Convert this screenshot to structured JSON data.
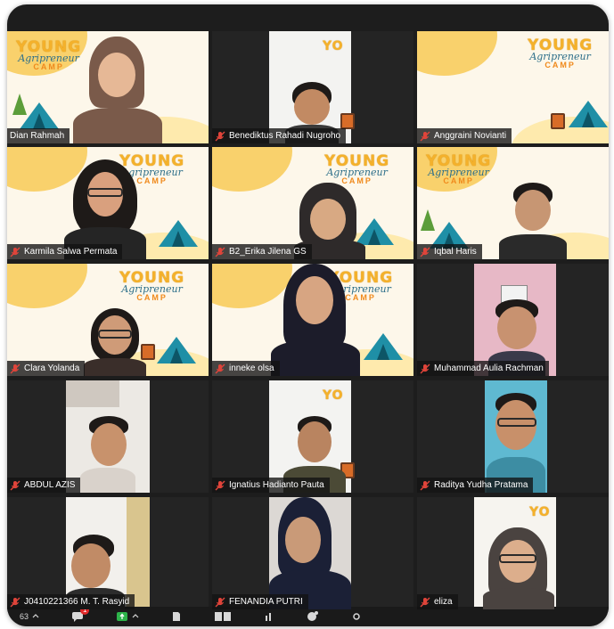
{
  "participants": [
    {
      "name": "Dian Rahmah",
      "muted": false,
      "active": true
    },
    {
      "name": "Benediktus Rahadi Nugroho",
      "muted": true,
      "active": false
    },
    {
      "name": "Anggraini Novianti",
      "muted": true,
      "active": false
    },
    {
      "name": "Karmila Salwa Permata",
      "muted": true,
      "active": false
    },
    {
      "name": "B2_Erika Jilena GS",
      "muted": true,
      "active": false
    },
    {
      "name": "Iqbal Haris",
      "muted": true,
      "active": false
    },
    {
      "name": "Clara Yolanda",
      "muted": true,
      "active": false
    },
    {
      "name": "inneke olsa",
      "muted": true,
      "active": false
    },
    {
      "name": "Muhammad Aulia Rachman",
      "muted": true,
      "active": false
    },
    {
      "name": "ABDUL AZIS",
      "muted": true,
      "active": false
    },
    {
      "name": "Ignatius Hadianto Pauta",
      "muted": true,
      "active": false
    },
    {
      "name": "Raditya Yudha Pratama",
      "muted": true,
      "active": false
    },
    {
      "name": "J0410221366 M. T. Rasyid",
      "muted": true,
      "active": false
    },
    {
      "name": "FENANDIA PUTRI",
      "muted": true,
      "active": false
    },
    {
      "name": "eliza",
      "muted": true,
      "active": false
    }
  ],
  "background": {
    "line1": "YOUNG",
    "line2": "Agripreneur",
    "line3": "CAMP"
  },
  "toolbar": {
    "participants_count": "63",
    "chat_badge": "1"
  },
  "colors": {
    "active_border": "#8bd43c",
    "muted_mic": "#e0443a",
    "brand_yellow": "#f4b12b",
    "tent": "#1f8fa6"
  }
}
